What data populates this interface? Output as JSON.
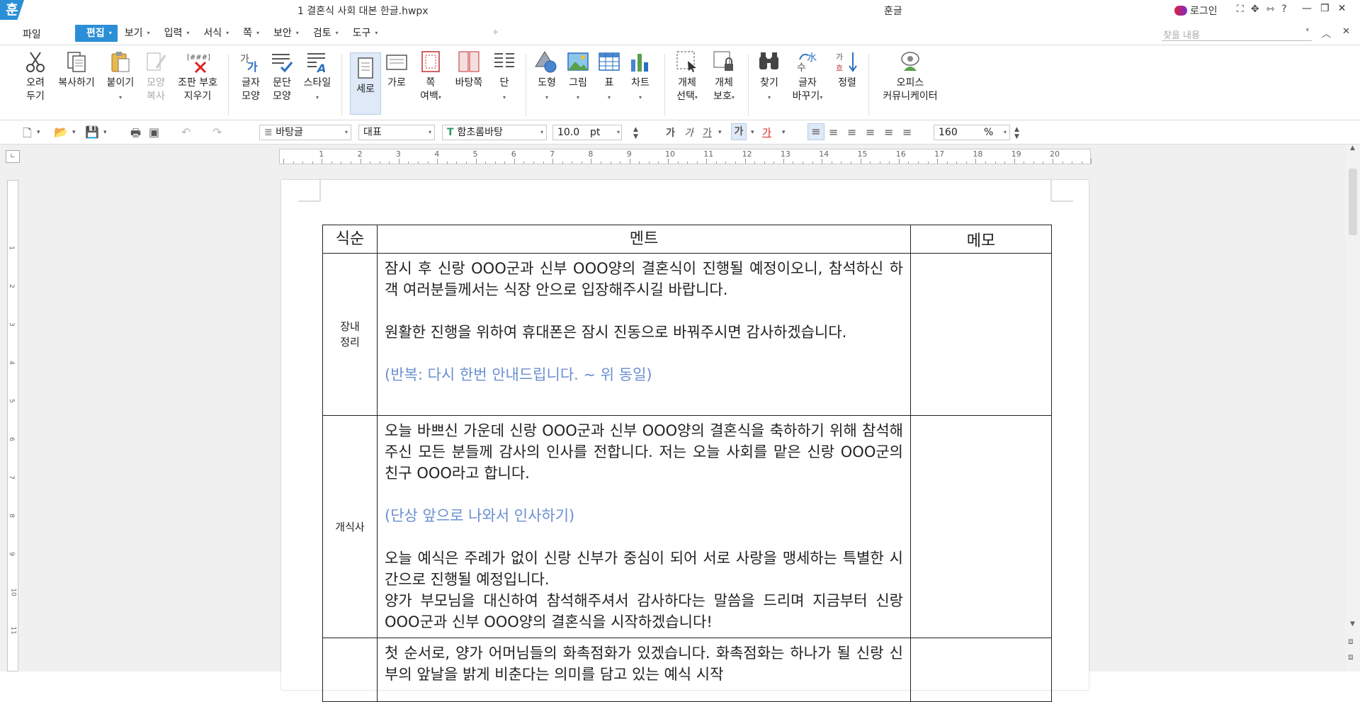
{
  "titlebar": {
    "logo": "훈",
    "document_title": "1 결혼식 사회 대본 한글.hwpx",
    "app_name": "훈글",
    "login_label": "로그인",
    "help": "?"
  },
  "menubar": {
    "file": "파일",
    "items": [
      {
        "label": "편집",
        "active": true
      },
      {
        "label": "보기"
      },
      {
        "label": "입력"
      },
      {
        "label": "서식"
      },
      {
        "label": "쪽"
      },
      {
        "label": "보안"
      },
      {
        "label": "검토"
      },
      {
        "label": "도구"
      }
    ],
    "search_placeholder": "찾을 내용"
  },
  "ribbon": {
    "cut": [
      "오려",
      "두기"
    ],
    "copy": "복사하기",
    "paste": "붙이기",
    "format_copy": [
      "모양",
      "복사"
    ],
    "clear_marks": [
      "조판 부호",
      "지우기"
    ],
    "char_shape": [
      "글자",
      "모양"
    ],
    "para_shape": [
      "문단",
      "모양"
    ],
    "style": "스타일",
    "portrait": "세로",
    "landscape": "가로",
    "margin": [
      "쪽",
      "여백"
    ],
    "background": "바탕쪽",
    "columns": "단",
    "shape": "도형",
    "picture": "그림",
    "table": "표",
    "chart": "차트",
    "obj_select": [
      "개체",
      "선택"
    ],
    "obj_protect": [
      "개체",
      "보호"
    ],
    "find": "찾기",
    "replace": [
      "글자",
      "바꾸기"
    ],
    "sort": "정렬",
    "office": [
      "오피스",
      "커뮤니케이터"
    ]
  },
  "formatbar": {
    "style": "바탕글",
    "lang": "대표",
    "font": "함초롬바탕",
    "size": "10.0",
    "unit": "pt",
    "bold": "가",
    "italic": "가",
    "underline": "가",
    "zoom": "160",
    "zoom_unit": "%"
  },
  "ruler": {
    "ticks": [
      "1",
      "2",
      "3",
      "4",
      "5",
      "6",
      "7",
      "8",
      "9",
      "10",
      "11",
      "12",
      "13",
      "14",
      "15",
      "16",
      "17",
      "18",
      "19",
      "20"
    ]
  },
  "table": {
    "headers": [
      "식순",
      "멘트",
      "메모"
    ],
    "rows": [
      {
        "label": "장내\n정리",
        "lines": [
          "잠시 후 신랑 OOO군과 신부 OOO양의 결혼식이 진행될 예정이오니, 참석하신 하객 여러분들께서는 식장 안으로 입장해주시길 바랍니다.",
          "원활한 진행을 위하여 휴대폰은 잠시 진동으로 바꿔주시면 감사하겠습니다.",
          "(반복: 다시 한번 안내드립니다. ~ 위 동일)"
        ]
      },
      {
        "label": "개식사",
        "lines": [
          "오늘 바쁘신 가운데 신랑 OOO군과 신부 OOO양의 결혼식을 축하하기 위해 참석해주신 모든 분들께 감사의 인사를 전합니다. 저는 오늘 사회를 맡은 신랑 OOO군의 친구 OOO라고 합니다.",
          "(단상 앞으로 나와서 인사하기)",
          "오늘 예식은 주례가 없이 신랑 신부가 중심이 되어 서로 사랑을 맹세하는 특별한 시간으로 진행될 예정입니다.",
          "양가 부모님을 대신하여 참석해주셔서 감사하다는 말씀을 드리며 지금부터 신랑 OOO군과 신부 OOO양의 결혼식을 시작하겠습니다!"
        ]
      },
      {
        "label": "",
        "lines": [
          "첫 순서로, 양가 어머님들의 화촉점화가 있겠습니다. 화촉점화는 하나가 될 신랑 신부의 앞날을 밝게 비춘다는 의미를 담고 있는 예식 시작"
        ]
      }
    ]
  }
}
